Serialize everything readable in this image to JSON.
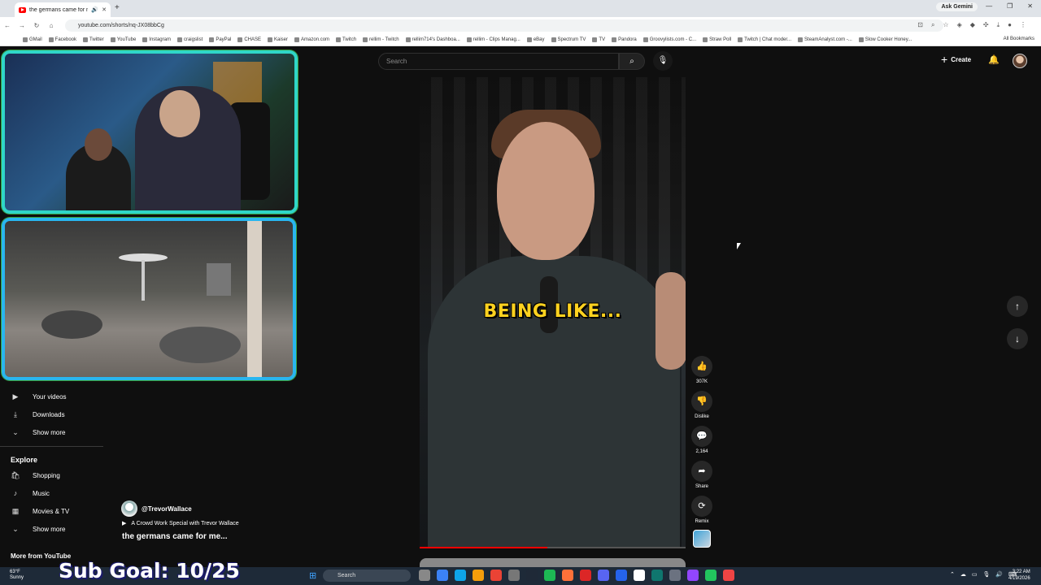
{
  "browser": {
    "tab_title": "the germans came for me...",
    "new_tab": "+",
    "ask_gemini": "Ask Gemini",
    "url": "youtube.com/shorts/nq-JX08bbCg",
    "all_bookmarks": "All Bookmarks",
    "bookmarks": [
      "GMail",
      "Facebook",
      "Twitter",
      "YouTube",
      "Instagram",
      "craigslist",
      "PayPal",
      "CHASE",
      "Kaiser",
      "Amazon.com",
      "Twitch",
      "rellim - Twitch",
      "rellim714's Dashboa...",
      "rellim - Clips Manag...",
      "eBay",
      "Spectrum TV",
      "TV",
      "Pandora",
      "Groovylists.com - C...",
      "Straw Poll",
      "Twitch | Chat moder...",
      "SteamAnalyst.com -...",
      "Slow Cooker Honey..."
    ]
  },
  "youtube": {
    "search_placeholder": "Search",
    "create_label": "Create",
    "sidebar": {
      "your_videos": "Your videos",
      "downloads": "Downloads",
      "show_more_1": "Show more",
      "explore_heading": "Explore",
      "shopping": "Shopping",
      "music": "Music",
      "movies_tv": "Movies & TV",
      "show_more_2": "Show more",
      "more_from_youtube": "More from YouTube"
    },
    "short": {
      "caption": "BEING LIKE...",
      "progress_percent": 48,
      "channel": "@TrevorWallace",
      "playlist": "A Crowd Work Special with Trevor Wallace",
      "title": "the germans came for me..."
    },
    "actions": {
      "likes": "307K",
      "dislike": "Dislike",
      "comments": "2,164",
      "share": "Share",
      "remix": "Remix"
    }
  },
  "overlay": {
    "sub_goal": "Sub Goal: 10/25"
  },
  "taskbar": {
    "weather_temp": "63°F",
    "weather_desc": "Sunny",
    "search": "Search",
    "time": "3:22 AM",
    "date": "4/19/2026"
  }
}
